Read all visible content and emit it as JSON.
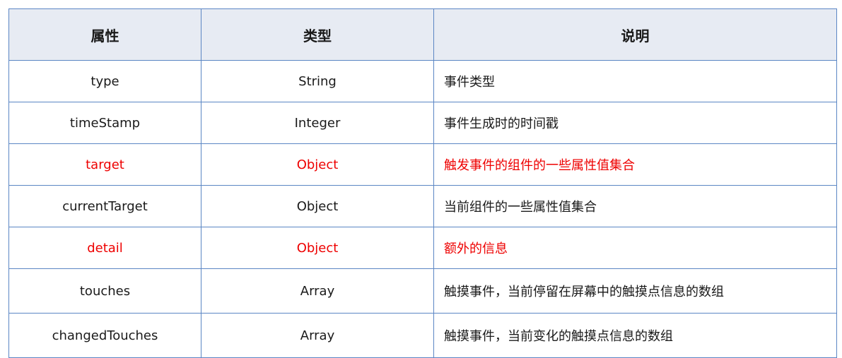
{
  "table": {
    "headers": [
      "属性",
      "类型",
      "说明"
    ],
    "rows": [
      {
        "name": "type",
        "type": "String",
        "desc": "事件类型",
        "highlight": false
      },
      {
        "name": "timeStamp",
        "type": "Integer",
        "desc": "事件生成时的时间戳",
        "highlight": false
      },
      {
        "name": "target",
        "type": "Object",
        "desc": "触发事件的组件的一些属性值集合",
        "highlight": true
      },
      {
        "name": "currentTarget",
        "type": "Object",
        "desc": "当前组件的一些属性值集合",
        "highlight": false
      },
      {
        "name": "detail",
        "type": "Object",
        "desc": "额外的信息",
        "highlight": true
      },
      {
        "name": "touches",
        "type": "Array",
        "desc": "触摸事件，当前停留在屏幕中的触摸点信息的数组",
        "highlight": false
      },
      {
        "name": "changedTouches",
        "type": "Array",
        "desc": "触摸事件，当前变化的触摸点信息的数组",
        "highlight": false
      }
    ]
  },
  "colors": {
    "border": "#5b86c4",
    "header_bg": "#e7ebf3",
    "highlight_text": "#ee0000"
  }
}
